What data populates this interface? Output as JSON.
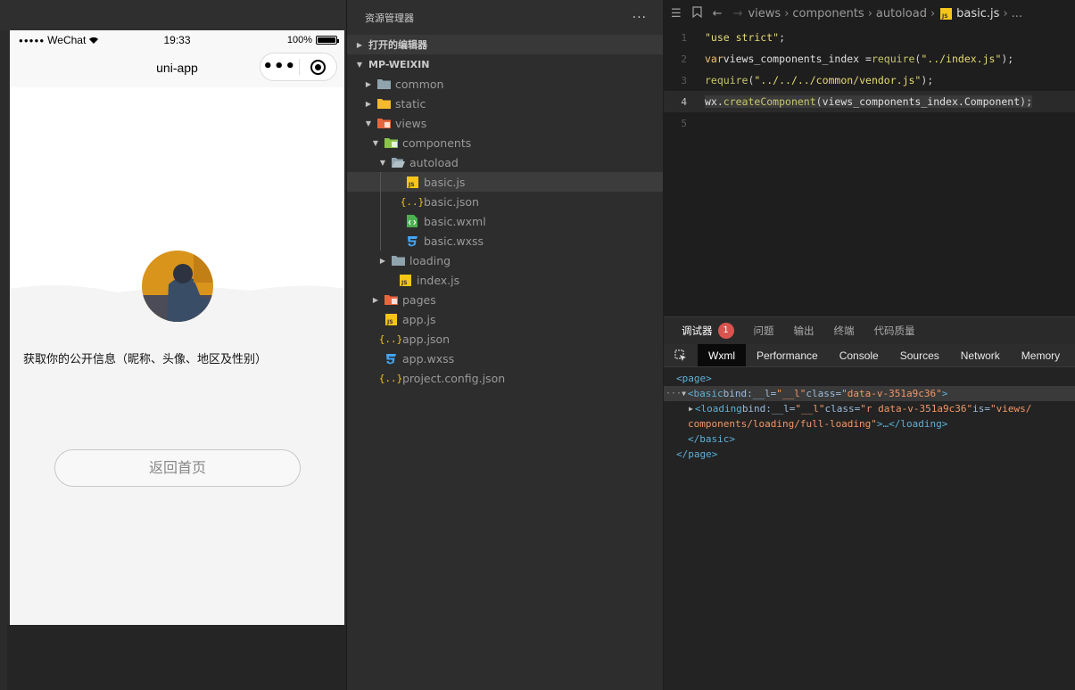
{
  "simulator": {
    "status": {
      "carrier": "WeChat",
      "time": "19:33",
      "battery": "100%"
    },
    "nav_title": "uni-app",
    "capsule_more": "•••",
    "info_text": "获取你的公开信息（昵称、头像、地区及性别）",
    "back_button": "返回首页"
  },
  "explorer": {
    "title": "资源管理器",
    "more": "···",
    "open_editors": "打开的编辑器",
    "project": "MP-WEIXIN",
    "tree": {
      "common": "common",
      "static": "static",
      "views": "views",
      "components": "components",
      "autoload": "autoload",
      "basic_js": "basic.js",
      "basic_json": "basic.json",
      "basic_wxml": "basic.wxml",
      "basic_wxss": "basic.wxss",
      "loading": "loading",
      "index_js": "index.js",
      "pages": "pages",
      "app_js": "app.js",
      "app_json": "app.json",
      "app_wxss": "app.wxss",
      "project_config": "project.config.json"
    }
  },
  "editor": {
    "breadcrumbs": [
      "views",
      "components",
      "autoload",
      "basic.js",
      "..."
    ],
    "lines": [
      {
        "n": "1",
        "str": "\"use strict\"",
        "end": ";"
      },
      {
        "n": "2",
        "kw": "var",
        "id": " views_components_index = ",
        "fn": "require",
        "open": "(",
        "str": "\"../index.js\"",
        "end": ");"
      },
      {
        "n": "3",
        "fn": "require",
        "open": "(",
        "str": "\"../../../common/vendor.js\"",
        "end": ");"
      },
      {
        "n": "4",
        "id": "wx.",
        "fn": "createComponent",
        "open": "(",
        "arg": "views_components_index.Component",
        "end": ");"
      },
      {
        "n": "5"
      }
    ]
  },
  "debugger": {
    "tabs": [
      "调试器",
      "问题",
      "输出",
      "终端",
      "代码质量"
    ],
    "badge": "1",
    "devtools_tabs": [
      "Wxml",
      "Performance",
      "Console",
      "Sources",
      "Network",
      "Memory"
    ],
    "dom": {
      "page_open": "<page>",
      "basic_tag": "<basic",
      "basic_bind_attr": " bind:__l=",
      "basic_bind_val": "\"__l\"",
      "basic_class_attr": " class=",
      "basic_class_val": "\"data-v-351a9c36\"",
      "basic_close": ">",
      "loading_tag": "<loading",
      "loading_bind_attr": " bind:__l=",
      "loading_bind_val": "\"__l\"",
      "loading_class_attr": " class=",
      "loading_class_val": "\"r data-v-351a9c36\"",
      "loading_is_attr": " is=",
      "loading_is_val": "\"views/",
      "loading_is_val2": "components/loading/full-loading\"",
      "loading_close": ">…</loading>",
      "basic_end": "</basic>",
      "page_end": "</page>"
    }
  },
  "colors": {
    "folder": "#90a4ae",
    "js": "#f5c518",
    "json": "#f5c518",
    "wxml": "#4caf50",
    "wxss": "#42a5f5",
    "badge": "#d9534f"
  }
}
